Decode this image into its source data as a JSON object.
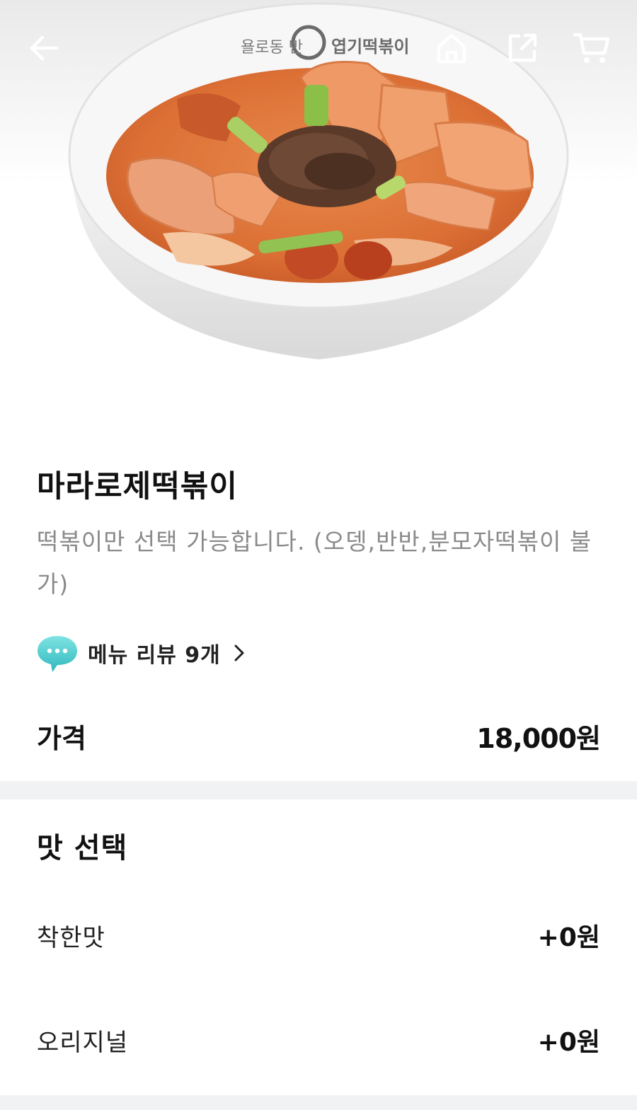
{
  "header": {
    "back_icon": "back-arrow-icon",
    "home_icon": "home-icon",
    "share_icon": "share-icon",
    "cart_icon": "cart-icon",
    "icon_color": "#ffffff"
  },
  "hero": {
    "image": "tteokbokki-bowl-photo",
    "bowl_brand": "엽기떡볶이"
  },
  "menu": {
    "title": "마라로제떡볶이",
    "description": "떡볶이만 선택 가능합니다. (오뎅,반반,분모자떡볶이 불가)",
    "review_icon": "chat-bubble-icon",
    "review_label": "메뉴 리뷰 9개",
    "review_icon_color": "#3ec9c9"
  },
  "price": {
    "label": "가격",
    "value": "18,000원"
  },
  "taste": {
    "title": "맛 선택",
    "options": [
      {
        "name": "착한맛",
        "price": "+0원"
      },
      {
        "name": "오리지널",
        "price": "+0원"
      }
    ]
  }
}
